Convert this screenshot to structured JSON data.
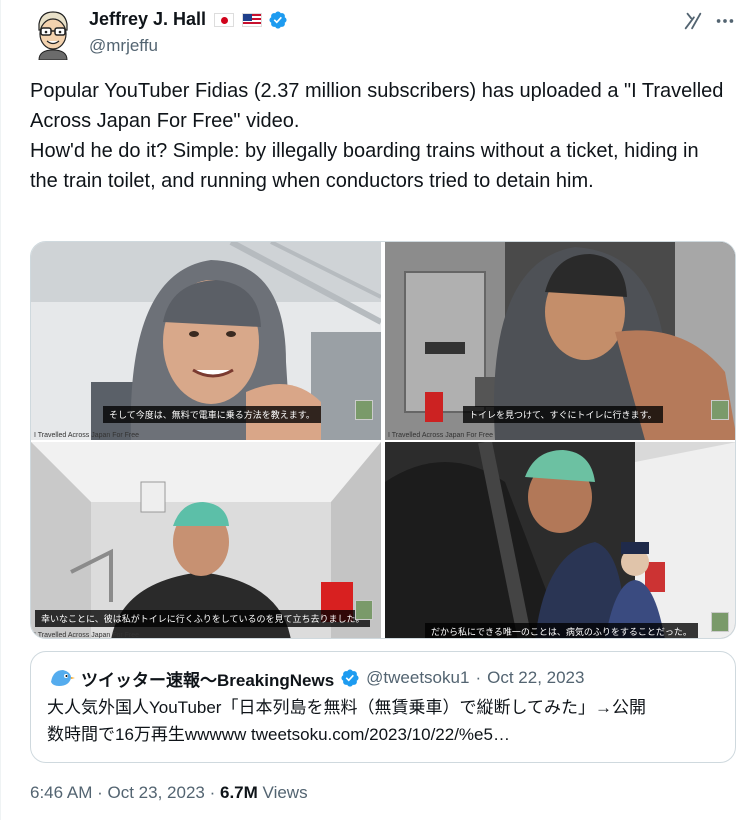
{
  "author": {
    "display_name": "Jeffrey J. Hall",
    "handle": "@mrjeffu",
    "flags": [
      "japan-flag",
      "us-flag"
    ],
    "verified_color": "#1d9bf0"
  },
  "tweet": {
    "lines": [
      "Popular YouTuber Fidias (2.37 million subscribers) has uploaded a \"I Travelled Across Japan For Free\" video.",
      "How'd he do it?  Simple: by illegally boarding trains without a ticket, hiding in the train toilet, and running when conductors tried to detain him."
    ]
  },
  "media": {
    "images": [
      {
        "subtitle": "そして今度は、無料で電車に乗る方法を教えます。",
        "caption": "I Travelled Across Japan For Free"
      },
      {
        "subtitle": "トイレを見つけて、すぐにトイレに行きます。",
        "caption": "I Travelled Across Japan For Free"
      },
      {
        "subtitle": "幸いなことに、彼は私がトイレに行くふりをしているのを見て立ち去りました。",
        "caption": "I Travelled Across Japan For Free"
      },
      {
        "subtitle": "だから私にできる唯一のことは、病気のふりをすることだった。",
        "caption": ""
      }
    ]
  },
  "quote": {
    "name": "ツイッター速報〜BreakingNews",
    "handle": "@tweetsoku1",
    "date": "Oct 22, 2023",
    "line1": "大人気外国人YouTuber「日本列島を無料（無賃乗車）で縦断してみた」→公開",
    "line2": "数時間で16万再生wwwww tweetsoku.com/2023/10/22/%e5…"
  },
  "footer": {
    "time": "6:46 AM",
    "date": "Oct 23, 2023",
    "views_count": "6.7M",
    "views_label": "Views",
    "separator": "·"
  },
  "colors": {
    "text": "#0f1419",
    "muted": "#536471",
    "border": "#cfd9de",
    "verified": "#1d9bf0"
  }
}
